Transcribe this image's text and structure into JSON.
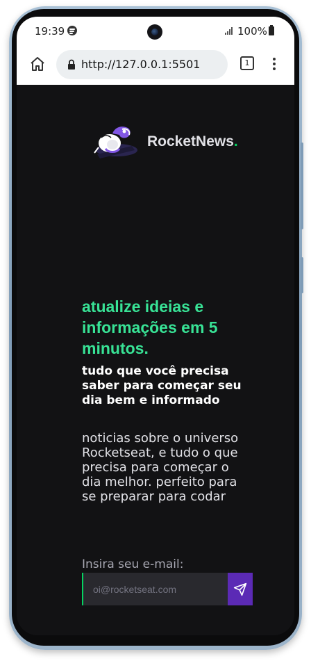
{
  "status_bar": {
    "time": "19:39",
    "battery": "100%",
    "icons": [
      "spotify-icon",
      "camera-punch-hole",
      "signal-icon",
      "battery-icon"
    ]
  },
  "browser": {
    "url": "http://127.0.0.1:5501",
    "tab_count": "1",
    "icons": [
      "home-icon",
      "lock-icon",
      "tabs-icon",
      "more-vert-icon"
    ]
  },
  "page": {
    "brand": {
      "name": "RocketNews",
      "dot": "."
    },
    "headline": "atualize ideias e informações em 5 minutos.",
    "subheadline": "tudo que você precisa saber para começar seu dia bem e informado",
    "description": "noticias sobre o universo Rocketseat, e tudo o que precisa para começar o dia melhor. perfeito para se preparar para codar",
    "form": {
      "label": "Insira seu e-mail:",
      "placeholder": "oi@rocketseat.com",
      "value": "",
      "submit_icon": "send-icon"
    }
  },
  "colors": {
    "background": "#121214",
    "accent_green": "#38e396",
    "brand_dot": "#04d361",
    "button_purple": "#5b2ab5",
    "input_bg": "#29292e"
  }
}
